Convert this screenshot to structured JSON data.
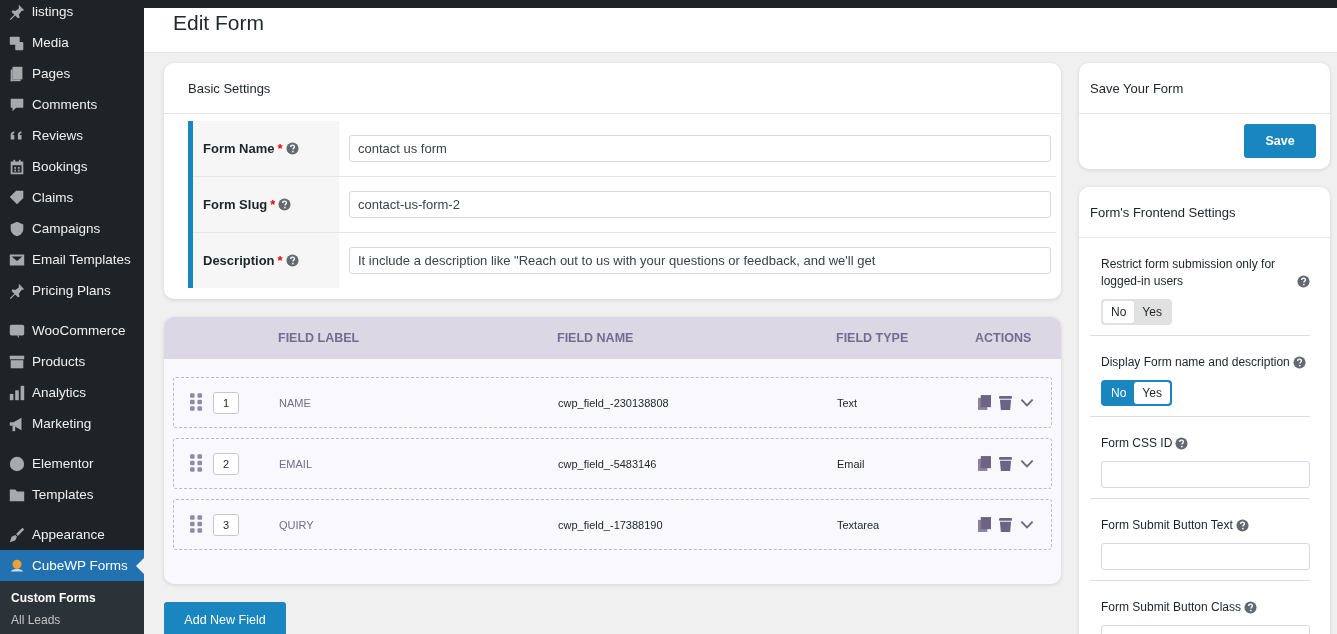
{
  "sidebar": {
    "groups": [
      {
        "items": [
          {
            "label": "listings",
            "selected": false
          },
          {
            "label": "Media",
            "selected": false
          },
          {
            "label": "Pages",
            "selected": false
          },
          {
            "label": "Comments",
            "selected": false
          },
          {
            "label": "Reviews",
            "selected": false
          },
          {
            "label": "Bookings",
            "selected": false
          },
          {
            "label": "Claims",
            "selected": false
          },
          {
            "label": "Campaigns",
            "selected": false
          },
          {
            "label": "Email Templates",
            "selected": false
          },
          {
            "label": "Pricing Plans",
            "selected": false
          }
        ]
      },
      {
        "items": [
          {
            "label": "WooCommerce",
            "selected": false
          },
          {
            "label": "Products",
            "selected": false
          },
          {
            "label": "Analytics",
            "selected": false
          },
          {
            "label": "Marketing",
            "selected": false
          }
        ]
      },
      {
        "items": [
          {
            "label": "Elementor",
            "selected": false
          },
          {
            "label": "Templates",
            "selected": false
          }
        ]
      },
      {
        "items": [
          {
            "label": "Appearance",
            "selected": false
          },
          {
            "label": "CubeWP Forms",
            "selected": true,
            "children": [
              {
                "label": "Custom Forms",
                "selected": true
              },
              {
                "label": "All Leads",
                "selected": false
              }
            ]
          }
        ]
      }
    ]
  },
  "page_title": "Edit Form",
  "basic_settings": {
    "title": "Basic Settings",
    "rows": [
      {
        "label": "Form Name",
        "required_mark": "*",
        "value": "contact us form"
      },
      {
        "label": "Form Slug",
        "required_mark": "*",
        "value": "contact-us-form-2"
      },
      {
        "label": "Description",
        "required_mark": "*",
        "value": "It include a description like \"Reach out to us with your questions or feedback, and we'll get"
      }
    ]
  },
  "fields_table": {
    "columns": [
      "FIELD LABEL",
      "FIELD NAME",
      "FIELD TYPE",
      "ACTIONS"
    ],
    "rows": [
      {
        "order": "1",
        "label": "NAME",
        "name": "cwp_field_-230138808",
        "type": "Text"
      },
      {
        "order": "2",
        "label": "EMAIL",
        "name": "cwp_field_-5483146",
        "type": "Email"
      },
      {
        "order": "3",
        "label": "QUIRY",
        "name": "cwp_field_-17388190",
        "type": "Textarea"
      }
    ]
  },
  "add_button": "Add New Field",
  "save_card": {
    "title": "Save Your Form",
    "button": "Save"
  },
  "frontend_settings": {
    "title": "Form's Frontend Settings",
    "settings": [
      {
        "kind": "toggle",
        "label": "Restrict form submission only for logged-in users",
        "off_label": "No",
        "on_label": "Yes",
        "on": false
      },
      {
        "kind": "toggle",
        "label": "Display Form name and description",
        "off_label": "No",
        "on_label": "Yes",
        "on": true
      },
      {
        "kind": "text",
        "label": "Form CSS ID"
      },
      {
        "kind": "text",
        "label": "Form Submit Button Text"
      },
      {
        "kind": "text",
        "label": "Form Submit Button Class"
      }
    ]
  }
}
